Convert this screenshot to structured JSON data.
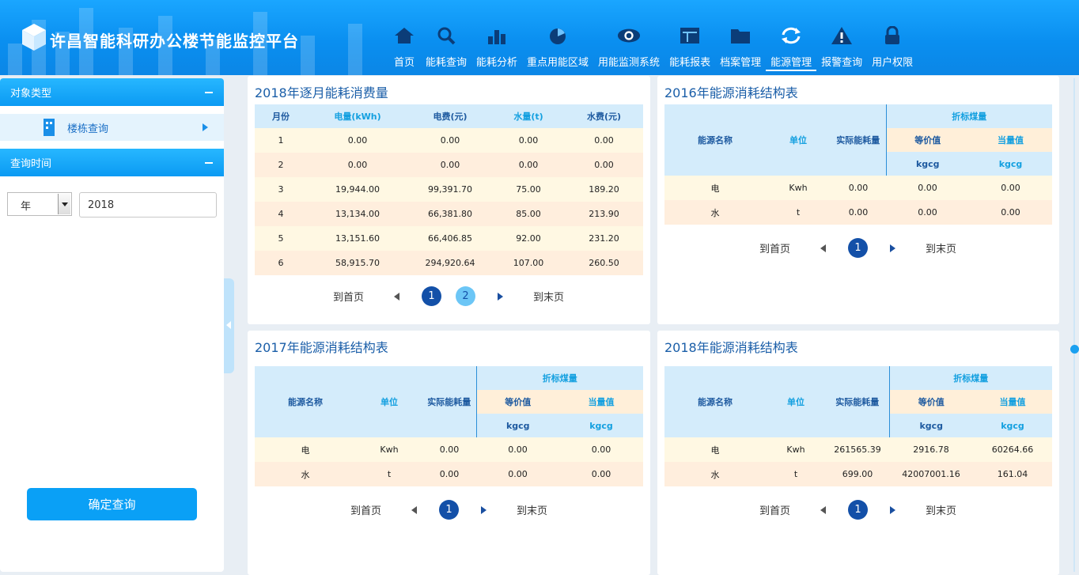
{
  "app": {
    "title": "许昌智能科研办公楼节能监控平台"
  },
  "nav": [
    {
      "label": "首页",
      "icon": "home-icon"
    },
    {
      "label": "能耗查询",
      "icon": "search-icon"
    },
    {
      "label": "能耗分析",
      "icon": "bar-chart-icon"
    },
    {
      "label": "重点用能区域",
      "icon": "pie-chart-icon"
    },
    {
      "label": "用能监测系统",
      "icon": "eye-icon"
    },
    {
      "label": "能耗报表",
      "icon": "table-icon"
    },
    {
      "label": "档案管理",
      "icon": "folder-icon"
    },
    {
      "label": "能源管理",
      "icon": "refresh-icon",
      "active": true
    },
    {
      "label": "报警查询",
      "icon": "warning-icon"
    },
    {
      "label": "用户权限",
      "icon": "lock-icon"
    }
  ],
  "sidebar": {
    "section1_title": "对象类型",
    "item_label": "楼栋查询",
    "section2_title": "查询时间",
    "period_select": "年",
    "year_value": "2018",
    "confirm_label": "确定查询"
  },
  "monthly": {
    "title": "2018年逐月能耗消费量",
    "headers": [
      "月份",
      "电量(kWh)",
      "电费(元)",
      "水量(t)",
      "水费(元)"
    ],
    "rows": [
      [
        "1",
        "0.00",
        "0.00",
        "0.00",
        "0.00"
      ],
      [
        "2",
        "0.00",
        "0.00",
        "0.00",
        "0.00"
      ],
      [
        "3",
        "19,944.00",
        "99,391.70",
        "75.00",
        "189.20"
      ],
      [
        "4",
        "13,134.00",
        "66,381.80",
        "85.00",
        "213.90"
      ],
      [
        "5",
        "13,151.60",
        "66,406.85",
        "92.00",
        "231.20"
      ],
      [
        "6",
        "58,915.70",
        "294,920.64",
        "107.00",
        "260.50"
      ]
    ],
    "pager": {
      "first": "到首页",
      "last": "到末页",
      "pages": [
        "1",
        "2"
      ]
    }
  },
  "struct_headers": {
    "name": "能源名称",
    "unit": "单位",
    "actual": "实际能耗量",
    "group": "折标煤量",
    "equiv": "等价值",
    "equal": "当量值",
    "u1": "kgcg",
    "u2": "kgcg"
  },
  "struct2016": {
    "title": "2016年能源消耗结构表",
    "rows": [
      [
        "电",
        "Kwh",
        "0.00",
        "0.00",
        "0.00"
      ],
      [
        "水",
        "t",
        "0.00",
        "0.00",
        "0.00"
      ]
    ],
    "pager": {
      "first": "到首页",
      "last": "到末页",
      "page": "1"
    }
  },
  "struct2017": {
    "title": "2017年能源消耗结构表",
    "rows": [
      [
        "电",
        "Kwh",
        "0.00",
        "0.00",
        "0.00"
      ],
      [
        "水",
        "t",
        "0.00",
        "0.00",
        "0.00"
      ]
    ],
    "pager": {
      "first": "到首页",
      "last": "到末页",
      "page": "1"
    }
  },
  "struct2018": {
    "title": "2018年能源消耗结构表",
    "rows": [
      [
        "电",
        "Kwh",
        "261565.39",
        "2916.78",
        "60264.66"
      ],
      [
        "水",
        "t",
        "699.00",
        "42007001.16",
        "161.04"
      ]
    ],
    "pager": {
      "first": "到首页",
      "last": "到末页",
      "page": "1"
    }
  }
}
